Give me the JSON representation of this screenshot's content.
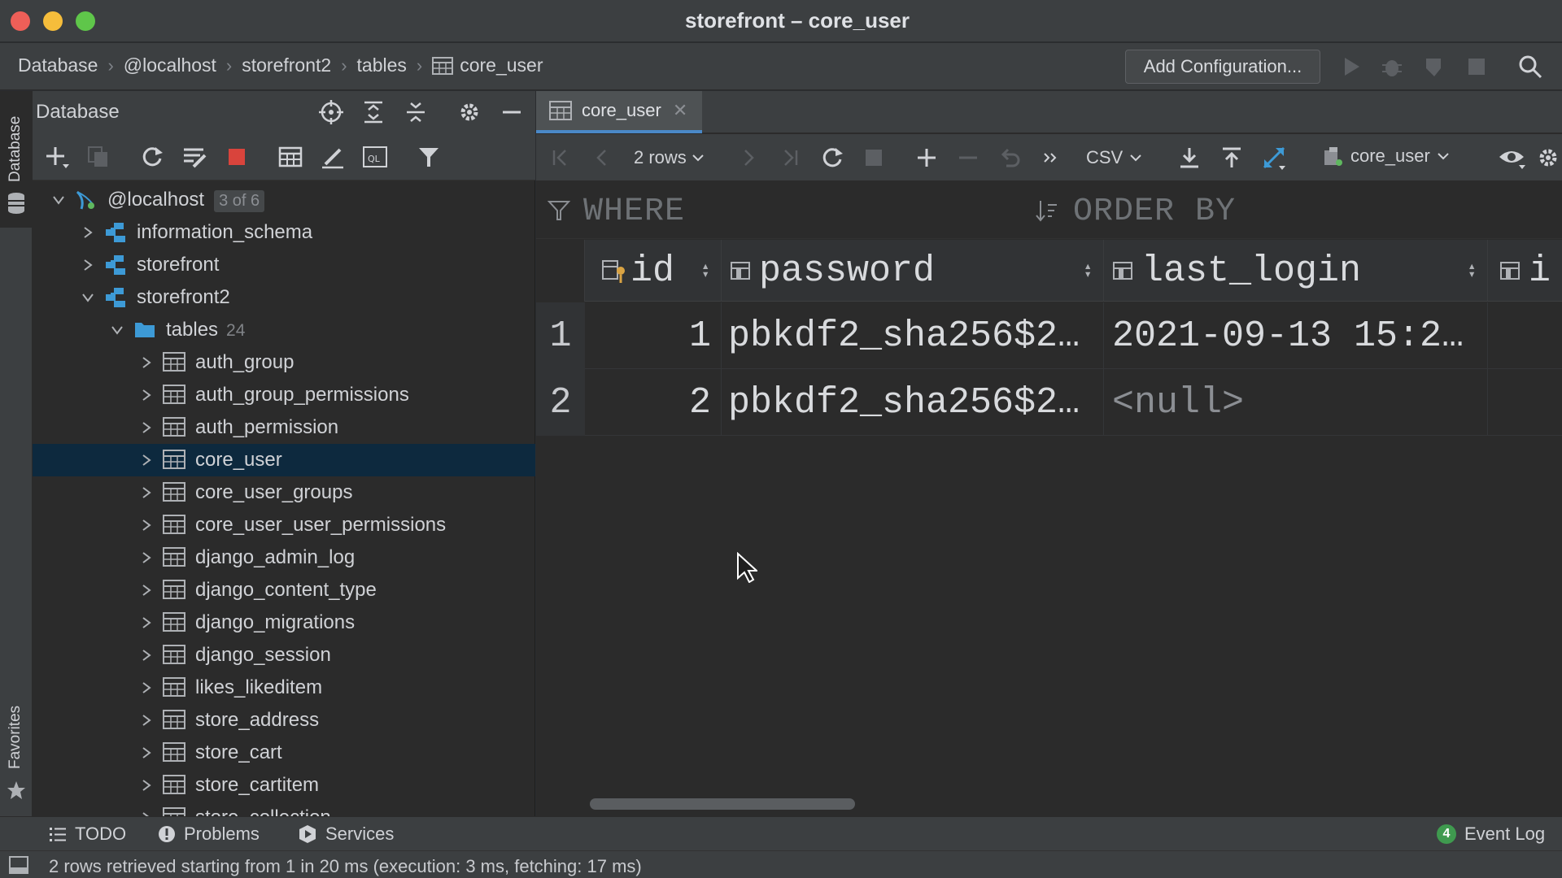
{
  "window": {
    "title": "storefront – core_user"
  },
  "breadcrumb": [
    "Database",
    "@localhost",
    "storefront2",
    "tables",
    "core_user"
  ],
  "navbar": {
    "add_configuration": "Add Configuration..."
  },
  "side_tabs": {
    "database": "Database",
    "favorites": "Favorites"
  },
  "db_panel": {
    "title": "Database",
    "tree": {
      "host": {
        "label": "@localhost",
        "badge": "3 of 6"
      },
      "schemas": [
        {
          "label": "information_schema"
        },
        {
          "label": "storefront"
        },
        {
          "label": "storefront2"
        }
      ],
      "tables_folder": {
        "label": "tables",
        "count": "24"
      },
      "tables": [
        "auth_group",
        "auth_group_permissions",
        "auth_permission",
        "core_user",
        "core_user_groups",
        "core_user_user_permissions",
        "django_admin_log",
        "django_content_type",
        "django_migrations",
        "django_session",
        "likes_likeditem",
        "store_address",
        "store_cart",
        "store_cartitem",
        "store_collection"
      ],
      "selected_table": "core_user"
    }
  },
  "editor": {
    "tab_label": "core_user",
    "toolbar": {
      "rows": "2 rows",
      "export_format": "CSV",
      "target": "core_user"
    },
    "filter": {
      "where": "WHERE",
      "order_by": "ORDER BY"
    },
    "columns": [
      "id",
      "password",
      "last_login",
      "i"
    ],
    "rows": [
      {
        "num": "1",
        "id": "1",
        "password": "pbkdf2_sha256$2…",
        "last_login": "2021-09-13 15:2…"
      },
      {
        "num": "2",
        "id": "2",
        "password": "pbkdf2_sha256$2…",
        "last_login": "<null>"
      }
    ]
  },
  "bottom": {
    "todo": "TODO",
    "problems": "Problems",
    "services": "Services",
    "event_count": "4",
    "event_log": "Event Log"
  },
  "status": {
    "message": "2 rows retrieved starting from 1 in 20 ms (execution: 3 ms, fetching: 17 ms)"
  },
  "colors": {
    "selection": "#0d293e",
    "accent": "#4a88c7",
    "stop": "#d9443c",
    "schema_icon": "#3d9ad6"
  }
}
